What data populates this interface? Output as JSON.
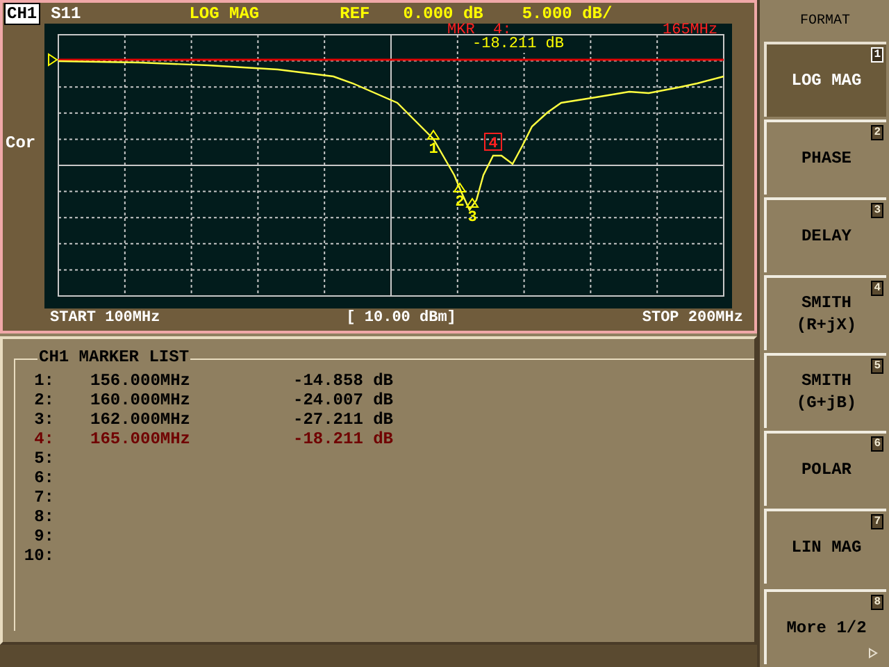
{
  "channel": "CH1",
  "parameter": "S11",
  "format": "LOG MAG",
  "ref_label": "REF",
  "ref_value": "0.000 dB",
  "scale": "5.000 dB/",
  "side_label": "Cor",
  "marker_readout": {
    "label": "MKR  4:",
    "frequency": "165MHz",
    "value": "-18.211 dB"
  },
  "trace_markers": [
    {
      "label": "1",
      "selected": false
    },
    {
      "label": "2",
      "selected": false
    },
    {
      "label": "3",
      "selected": false
    },
    {
      "label": "4",
      "selected": true
    }
  ],
  "footer": {
    "start": "START 100MHz",
    "power": "[ 10.00 dBm]",
    "stop": "STOP 200MHz"
  },
  "marker_list": {
    "title": "CH1 MARKER LIST",
    "rows": [
      {
        "number": "1:",
        "frequency": "156.000MHz",
        "value": "-14.858 dB",
        "selected": false
      },
      {
        "number": "2:",
        "frequency": "160.000MHz",
        "value": "-24.007 dB",
        "selected": false
      },
      {
        "number": "3:",
        "frequency": "162.000MHz",
        "value": "-27.211 dB",
        "selected": false
      },
      {
        "number": "4:",
        "frequency": "165.000MHz",
        "value": "-18.211 dB",
        "selected": true
      },
      {
        "number": "5:",
        "selected": false
      },
      {
        "number": "6:",
        "selected": false
      },
      {
        "number": "7:",
        "selected": false
      },
      {
        "number": "8:",
        "selected": false
      },
      {
        "number": "9:",
        "selected": false
      },
      {
        "number": "10:",
        "selected": false
      }
    ]
  },
  "menu": {
    "title": "FORMAT",
    "items": [
      {
        "lines": [
          "LOG MAG"
        ],
        "number": "1",
        "selected": true,
        "kind": "option"
      },
      {
        "lines": [
          "PHASE"
        ],
        "number": "2",
        "selected": false,
        "kind": "option"
      },
      {
        "lines": [
          "DELAY"
        ],
        "number": "3",
        "selected": false,
        "kind": "option"
      },
      {
        "lines": [
          "SMITH",
          "(R+jX)"
        ],
        "number": "4",
        "selected": false,
        "kind": "option"
      },
      {
        "lines": [
          "SMITH",
          "(G+jB)"
        ],
        "number": "5",
        "selected": false,
        "kind": "option"
      },
      {
        "lines": [
          "POLAR"
        ],
        "number": "6",
        "selected": false,
        "kind": "option"
      },
      {
        "lines": [
          "LIN MAG"
        ],
        "number": "7",
        "selected": false,
        "kind": "option"
      },
      {
        "lines": [
          "More 1/2"
        ],
        "number": "8",
        "selected": false,
        "kind": "more"
      }
    ]
  }
}
